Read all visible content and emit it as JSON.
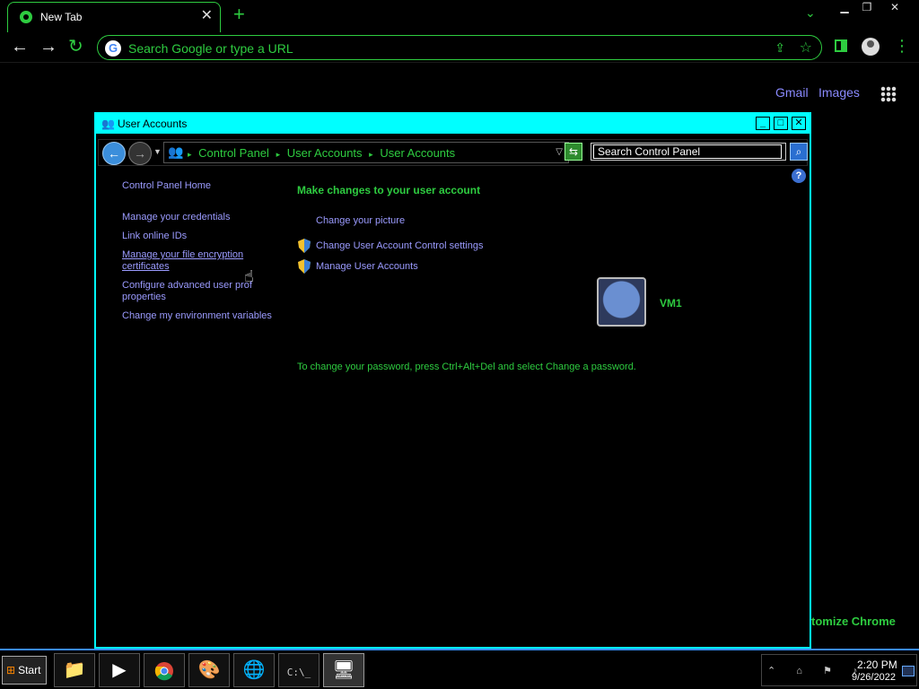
{
  "browser": {
    "tab_title": "New Tab",
    "tab_close": "✕",
    "new_tab": "+",
    "address_placeholder": "Search Google or type a URL",
    "ntp_links": {
      "gmail": "Gmail",
      "images": "Images"
    },
    "customize": "tomize Chrome"
  },
  "window": {
    "title": "User Accounts",
    "breadcrumbs": [
      "Control Panel",
      "User Accounts",
      "User Accounts"
    ],
    "search_placeholder": "Search Control Panel"
  },
  "left_nav": {
    "home": "Control Panel Home",
    "manage_credentials": "Manage your credentials",
    "link_online_ids": "Link online IDs",
    "file_encryption_1": "Manage your file encryption",
    "file_encryption_2": "certificates",
    "advanced_profile_1": "Configure advanced user prof",
    "advanced_profile_2": "properties",
    "env_vars": "Change my environment variables"
  },
  "main": {
    "heading": "Make changes to your user account",
    "change_picture": "Change your picture",
    "uac_settings": "Change User Account Control settings",
    "manage_accounts": "Manage User Accounts",
    "password_note": "To change your password, press Ctrl+Alt+Del and select Change a password.",
    "user_name": "VM1"
  },
  "taskbar": {
    "start": "Start",
    "time": "2:20 PM",
    "date": "9/26/2022"
  },
  "colors": {
    "accent_green": "#2ecc40",
    "window_border": "#00ffff",
    "link": "#9b9bff"
  }
}
